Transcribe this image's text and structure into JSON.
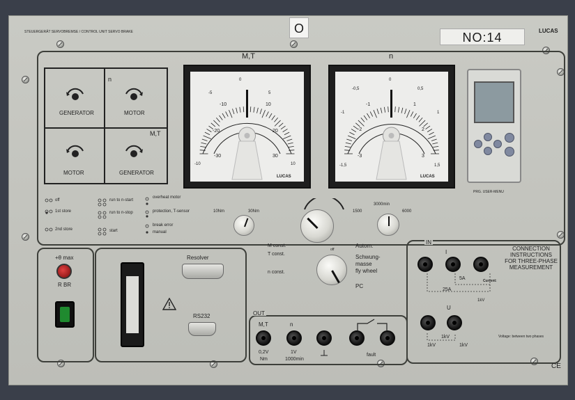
{
  "header": {
    "title": "STEUERGERÄT SERVOBREMSE / CONTROL UNIT SERVO BRAKE",
    "brand": "LUCAS",
    "number_label": "NO:14",
    "sticker": "O"
  },
  "quadrant": {
    "n_label": "n",
    "mt_label": "M,T",
    "q1": "GENERATOR",
    "q2": "MOTOR",
    "q3": "MOTOR",
    "q4": "GENERATOR"
  },
  "meters": {
    "mt": {
      "title": "M,T",
      "outer_labels": [
        "-10",
        "-5",
        "0",
        "5",
        "10"
      ],
      "inner_labels": [
        "-10",
        "-20",
        "-30",
        "10",
        "20",
        "30"
      ],
      "brand": "LUCAS"
    },
    "n": {
      "title": "n",
      "outer_labels": [
        "-1,5",
        "-1",
        "-0,5",
        "0",
        "0,5",
        "1",
        "1,5"
      ],
      "inner_labels": [
        "-1",
        "-2",
        "-3",
        "1",
        "2",
        "3"
      ],
      "brand": "LUCAS"
    }
  },
  "controller": {
    "caption": "PRG. USER-MENU"
  },
  "status": {
    "col1": [
      "off",
      "1st store",
      "2nd store"
    ],
    "col2": [
      "run to n-start",
      "run to n-stop",
      "start"
    ],
    "col3": [
      "overheat motor",
      "protection, T-sensor",
      "break error",
      "manual"
    ]
  },
  "knobs": {
    "torque_min": "10Nm",
    "torque_max": "30Nm",
    "speed_min": "1500",
    "speed_mid": "3000min",
    "speed_max": "6000"
  },
  "mode_switch": {
    "left": [
      "M const.",
      "T const.",
      "n const."
    ],
    "right": [
      "Autom.",
      "Schwung-",
      "masse",
      "fly wheel",
      "PC"
    ],
    "off": "off"
  },
  "brake": {
    "label_top": "+θ max",
    "label_rbr": "R BR"
  },
  "ports": {
    "resolver": "Resolver",
    "rs232": "RS232"
  },
  "out": {
    "title": "OUT",
    "top_labels": [
      "M,T",
      "n"
    ],
    "bottom_labels": [
      "0,2V",
      "Nm",
      "1V",
      "1000min",
      "fault"
    ]
  },
  "connection": {
    "in_label": "IN",
    "current_label": "I",
    "voltage_label": "U",
    "a5": "5A",
    "a25": "25A",
    "kv": "1kV",
    "heading": [
      "CONNECTION",
      "INSTRUCTIONS",
      "FOR THREE-PHASE",
      "MEASUREMENT"
    ],
    "current_note": "Current:",
    "voltage_note": "Voltage: between two phases"
  },
  "ce": "CE"
}
